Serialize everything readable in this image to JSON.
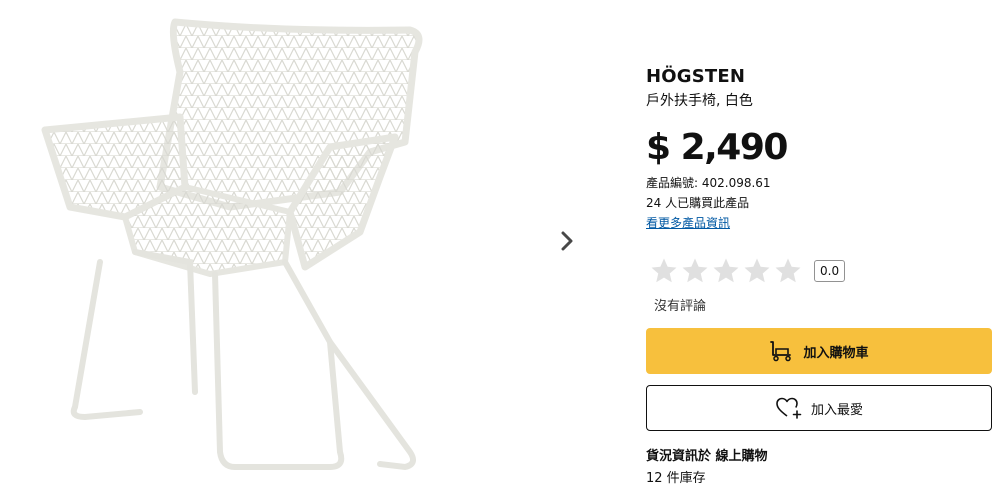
{
  "product": {
    "name": "HÖGSTEN",
    "description": "戶外扶手椅, 白色",
    "price": "$ 2,490",
    "article_number": "產品編號: 402.098.61",
    "purchased_count": "24 人已購買此產品",
    "more_info_link": "看更多產品資訊"
  },
  "rating": {
    "stars_filled": 0,
    "stars_total": 5,
    "score": "0.0",
    "no_reviews_text": "沒有評論"
  },
  "actions": {
    "add_to_cart": "加入購物車",
    "add_to_favorites": "加入最愛"
  },
  "availability": {
    "title": "貨況資訊於 線上購物",
    "stock": "12 件庫存"
  },
  "colors": {
    "cart_button": "#f7c03d",
    "link": "#0058a3",
    "star_empty": "#e0e0e0"
  },
  "icons": {
    "next": "chevron-right-icon",
    "cart": "cart-icon",
    "favorite": "heart-plus-icon",
    "star": "star-icon"
  }
}
